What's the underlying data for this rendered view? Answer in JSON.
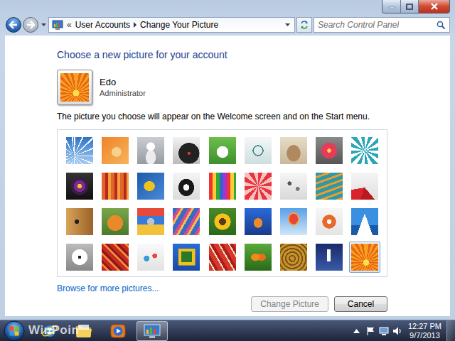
{
  "navigation": {
    "back_enabled": true,
    "forward_enabled": false
  },
  "address_bar": {
    "overflow": "«",
    "breadcrumbs": [
      "User Accounts",
      "Change Your Picture"
    ]
  },
  "search": {
    "placeholder": "Search Control Panel"
  },
  "heading": "Choose a new picture for your account",
  "account": {
    "name": "Edo",
    "role": "Administrator"
  },
  "description": "The picture you choose will appear on the Welcome screen and on the Start menu.",
  "pictures": [
    {
      "selected": false
    },
    {
      "selected": false
    },
    {
      "selected": false
    },
    {
      "selected": false
    },
    {
      "selected": false
    },
    {
      "selected": false
    },
    {
      "selected": false
    },
    {
      "selected": false
    },
    {
      "selected": false
    },
    {
      "selected": false
    },
    {
      "selected": false
    },
    {
      "selected": false
    },
    {
      "selected": false
    },
    {
      "selected": false
    },
    {
      "selected": false
    },
    {
      "selected": false
    },
    {
      "selected": false
    },
    {
      "selected": false
    },
    {
      "selected": false
    },
    {
      "selected": false
    },
    {
      "selected": false
    },
    {
      "selected": false
    },
    {
      "selected": false
    },
    {
      "selected": false
    },
    {
      "selected": false
    },
    {
      "selected": false
    },
    {
      "selected": false
    },
    {
      "selected": false
    },
    {
      "selected": false
    },
    {
      "selected": false
    },
    {
      "selected": false
    },
    {
      "selected": false
    },
    {
      "selected": false
    },
    {
      "selected": false
    },
    {
      "selected": false
    },
    {
      "selected": true
    }
  ],
  "browse_link": "Browse for more pictures...",
  "buttons": [
    {
      "label": "Change Picture",
      "disabled": true
    },
    {
      "label": "Cancel",
      "disabled": false
    }
  ],
  "taskbar": {
    "apps": [
      {
        "kind": "internet-explorer",
        "active": false
      },
      {
        "kind": "explorer",
        "active": false
      },
      {
        "kind": "media-player",
        "active": false
      },
      {
        "kind": "control-panel",
        "active": true
      }
    ],
    "clock": {
      "time": "12:27 PM",
      "date": "9/7/2013"
    }
  },
  "watermark": "WinPoin"
}
